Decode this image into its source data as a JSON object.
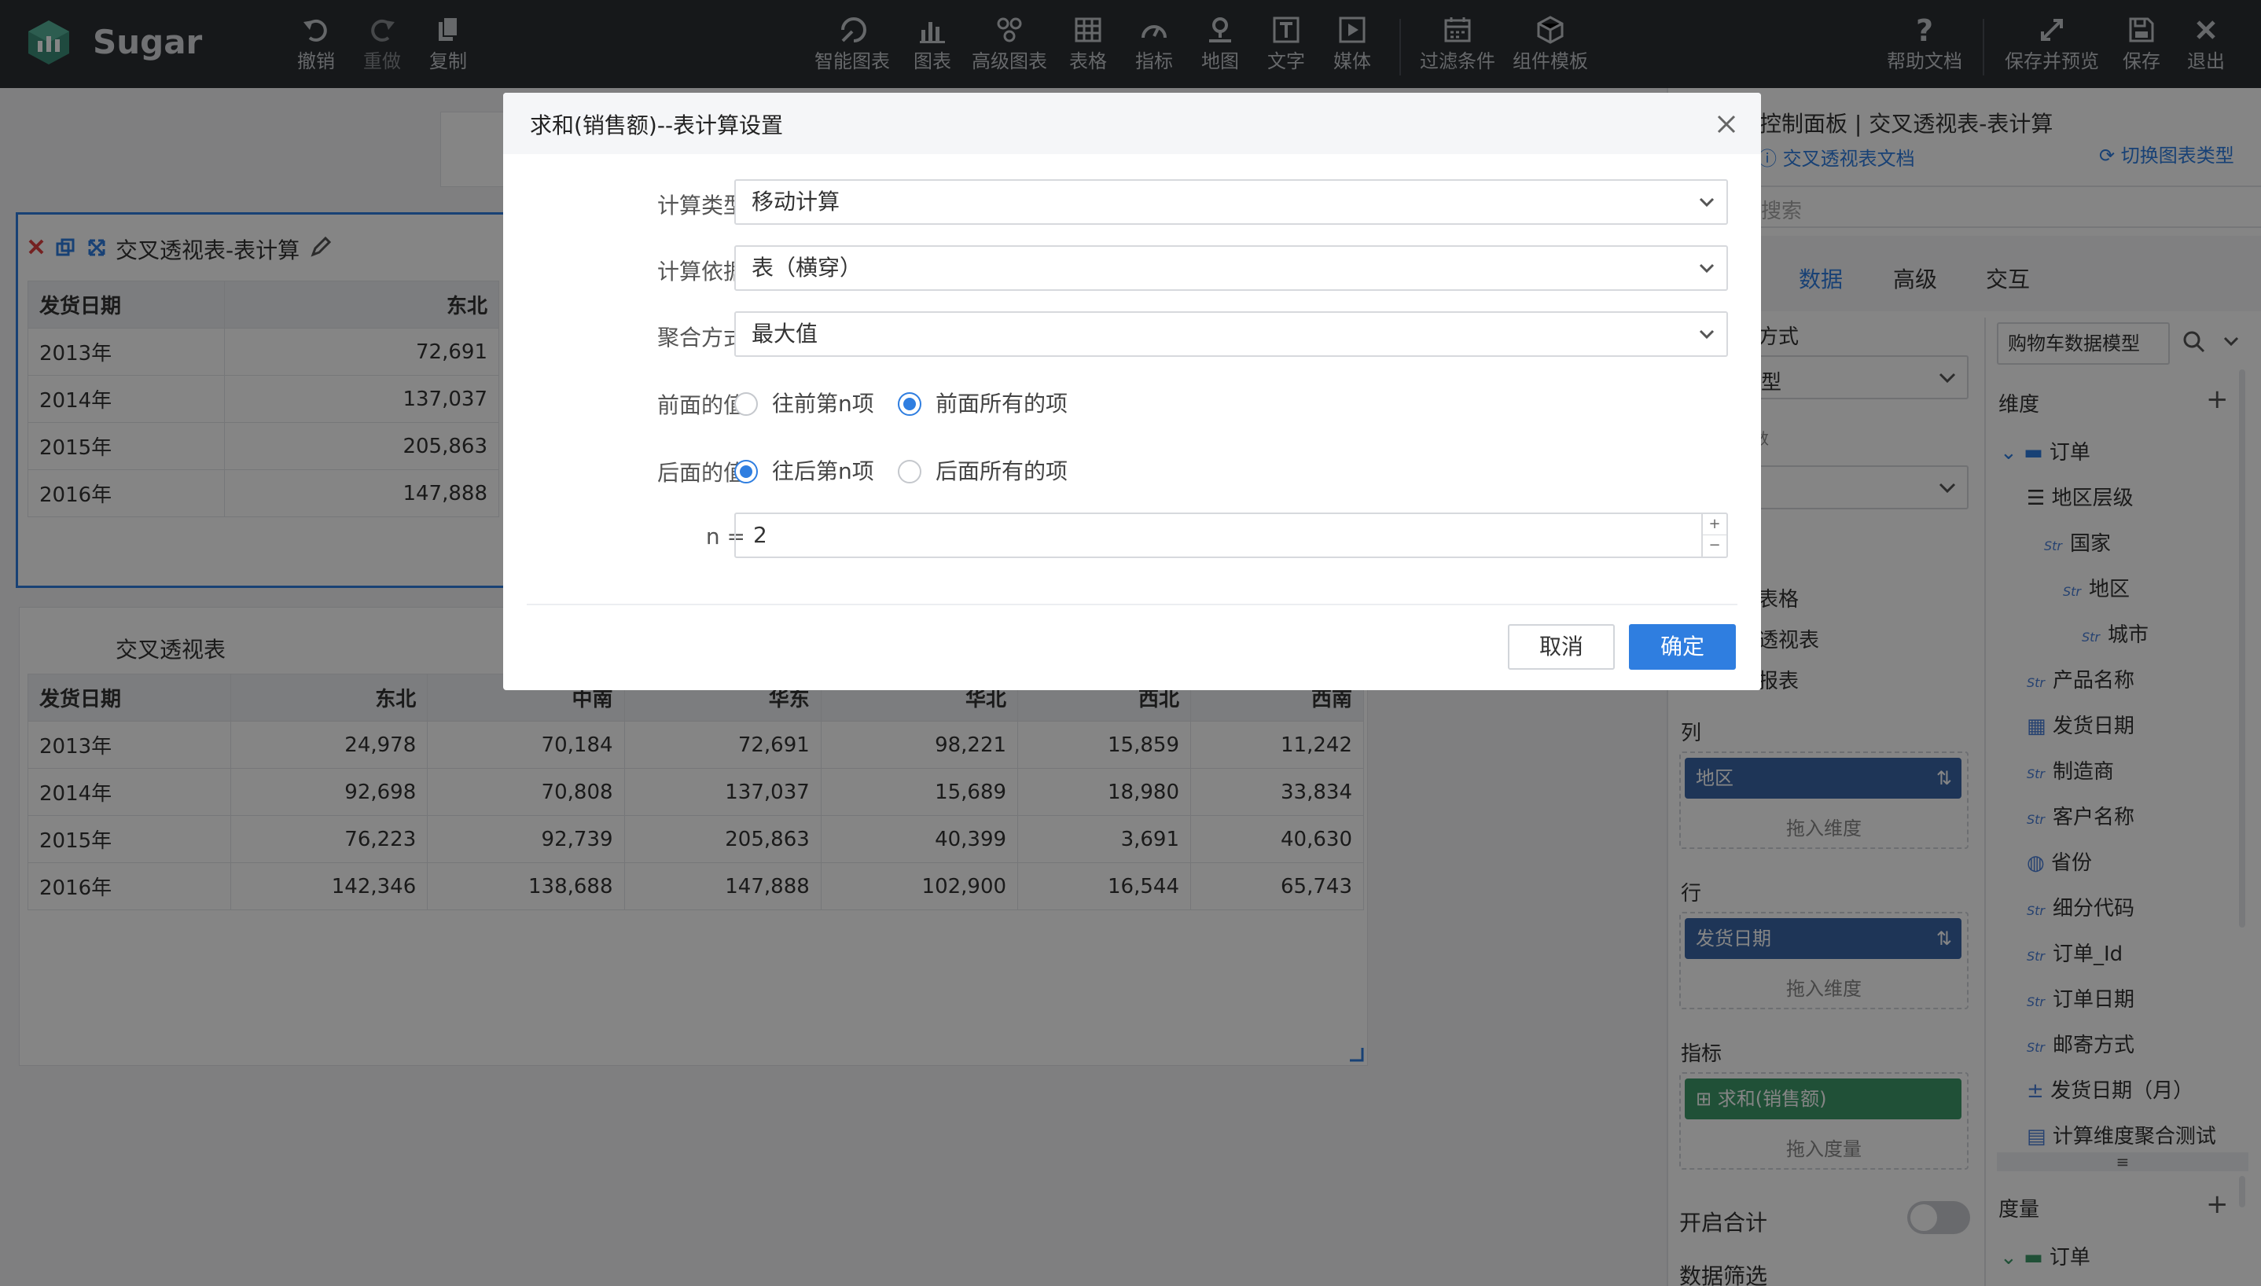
{
  "app": {
    "name": "Sugar"
  },
  "toolbar": {
    "undo": "撤销",
    "redo": "重做",
    "copy": "复制",
    "smart_chart": "智能图表",
    "chart": "图表",
    "advanced_chart": "高级图表",
    "table": "表格",
    "indicator": "指标",
    "map": "地图",
    "text": "文字",
    "media": "媒体",
    "filter": "过滤条件",
    "component_template": "组件模板",
    "help": "帮助文档",
    "save_preview": "保存并预览",
    "save": "保存",
    "exit": "退出"
  },
  "widget1": {
    "title": "交叉透视表-表计算",
    "headers": [
      "发货日期",
      "东北"
    ],
    "rows": [
      [
        "2013年",
        "72,691"
      ],
      [
        "2014年",
        "137,037"
      ],
      [
        "2015年",
        "205,863"
      ],
      [
        "2016年",
        "147,888"
      ]
    ]
  },
  "widget2": {
    "title": "交叉透视表",
    "headers": [
      "发货日期",
      "东北",
      "中南",
      "华东",
      "华北",
      "西北",
      "西南"
    ],
    "rows": [
      [
        "2013年",
        "24,978",
        "70,184",
        "72,691",
        "98,221",
        "15,859",
        "11,242"
      ],
      [
        "2014年",
        "92,698",
        "70,808",
        "137,037",
        "15,689",
        "18,980",
        "33,834"
      ],
      [
        "2015年",
        "76,223",
        "92,739",
        "205,863",
        "40,399",
        "3,691",
        "40,630"
      ],
      [
        "2016年",
        "142,346",
        "138,688",
        "147,888",
        "102,900",
        "16,544",
        "65,743"
      ]
    ]
  },
  "panel": {
    "header": "控制面板 | 交叉透视表-表计算",
    "doc_link": "交叉透视表文档",
    "switch_type": "切换图表类型",
    "search_placeholder": "搜索",
    "tabs": [
      "数据",
      "高级",
      "交互"
    ],
    "mode_label_partial": "方式",
    "mode_value_partial": "型",
    "partial_label2": "数",
    "chart_types_partial": [
      "表格",
      "透视表",
      "报表"
    ],
    "columns_label": "列",
    "column_pill": "地区",
    "drop_dimension": "拖入维度",
    "rows_label": "行",
    "row_pill": "发货日期",
    "measures_label": "指标",
    "measure_pill": "求和(销售额)",
    "drop_measure": "拖入度量",
    "total_toggle_label": "开启合计",
    "data_filter_label": "数据筛选",
    "model_select": "购物车数据模型",
    "dimension_header": "维度",
    "measure_header": "度量",
    "tree": [
      {
        "label": "订单",
        "icon": "folder-icon"
      },
      {
        "label": "地区层级",
        "icon": "hierarchy-icon"
      },
      {
        "label": "国家",
        "icon": "str-icon"
      },
      {
        "label": "地区",
        "icon": "str-icon"
      },
      {
        "label": "城市",
        "icon": "str-icon"
      },
      {
        "label": "产品名称",
        "icon": "str-icon"
      },
      {
        "label": "发货日期",
        "icon": "calendar-icon"
      },
      {
        "label": "制造商",
        "icon": "str-icon"
      },
      {
        "label": "客户名称",
        "icon": "str-icon"
      },
      {
        "label": "省份",
        "icon": "globe-icon"
      },
      {
        "label": "细分代码",
        "icon": "str-icon"
      },
      {
        "label": "订单_Id",
        "icon": "str-icon"
      },
      {
        "label": "订单日期",
        "icon": "str-icon"
      },
      {
        "label": "邮寄方式",
        "icon": "str-icon"
      },
      {
        "label": "发货日期（月）",
        "icon": "calc-icon"
      },
      {
        "label": "计算维度聚合测试",
        "icon": "calc-dim-icon"
      }
    ],
    "measure_tree": [
      {
        "label": "订单",
        "icon": "folder-icon"
      }
    ],
    "str_badge": "Str"
  },
  "dialog": {
    "title": "求和(销售额)--表计算设置",
    "calc_type_label": "计算类型",
    "calc_type_value": "移动计算",
    "calc_basis_label": "计算依据",
    "calc_basis_value": "表（横穿）",
    "agg_label": "聚合方式",
    "agg_value": "最大值",
    "prev_label": "前面的值",
    "prev_opt1": "往前第n项",
    "prev_opt2": "前面所有的项",
    "prev_selected": 2,
    "next_label": "后面的值",
    "next_opt1": "往后第n项",
    "next_opt2": "后面所有的项",
    "next_selected": 1,
    "n_label": "n =",
    "n_value": "2",
    "cancel": "取消",
    "ok": "确定"
  },
  "colors": {
    "topbar": "#2b2e33",
    "accent": "#2f7ee0",
    "pill_blue": "#3b67a8",
    "pill_green": "#3e9a6a"
  }
}
